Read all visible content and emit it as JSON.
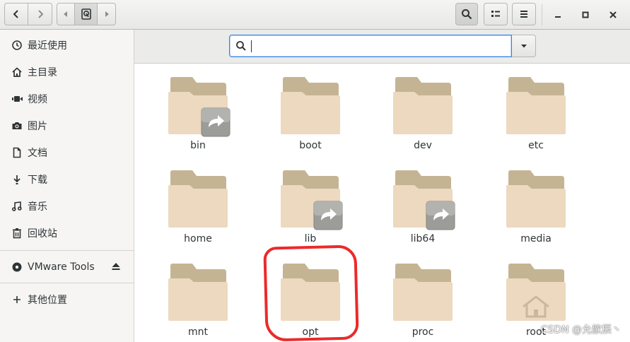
{
  "sidebar": {
    "items": [
      {
        "label": "最近使用",
        "icon": "clock-icon"
      },
      {
        "label": "主目录",
        "icon": "home-icon"
      },
      {
        "label": "视频",
        "icon": "video-icon"
      },
      {
        "label": "图片",
        "icon": "camera-icon"
      },
      {
        "label": "文档",
        "icon": "document-icon"
      },
      {
        "label": "下载",
        "icon": "download-icon"
      },
      {
        "label": "音乐",
        "icon": "music-icon"
      },
      {
        "label": "回收站",
        "icon": "trash-icon"
      }
    ],
    "device": {
      "label": "VMware Tools",
      "icon": "disc-icon",
      "action_icon": "eject-icon"
    },
    "other": {
      "label": "其他位置",
      "icon": "plus-icon"
    }
  },
  "search": {
    "value": "",
    "icon": "search-icon"
  },
  "folders": [
    {
      "name": "bin",
      "link": true,
      "home": false
    },
    {
      "name": "boot",
      "link": false,
      "home": false
    },
    {
      "name": "dev",
      "link": false,
      "home": false
    },
    {
      "name": "etc",
      "link": false,
      "home": false
    },
    {
      "name": "home",
      "link": false,
      "home": false
    },
    {
      "name": "lib",
      "link": true,
      "home": false
    },
    {
      "name": "lib64",
      "link": true,
      "home": false
    },
    {
      "name": "media",
      "link": false,
      "home": false
    },
    {
      "name": "mnt",
      "link": false,
      "home": false
    },
    {
      "name": "opt",
      "link": false,
      "home": false
    },
    {
      "name": "proc",
      "link": false,
      "home": false
    },
    {
      "name": "root",
      "link": false,
      "home": true
    }
  ],
  "colors": {
    "folder_front": "#ecd9bf",
    "folder_back": "#c5b493",
    "accent": "#3584e4",
    "highlight": "#ec2a2a"
  },
  "watermark": "CSDN @允歆辰丶"
}
